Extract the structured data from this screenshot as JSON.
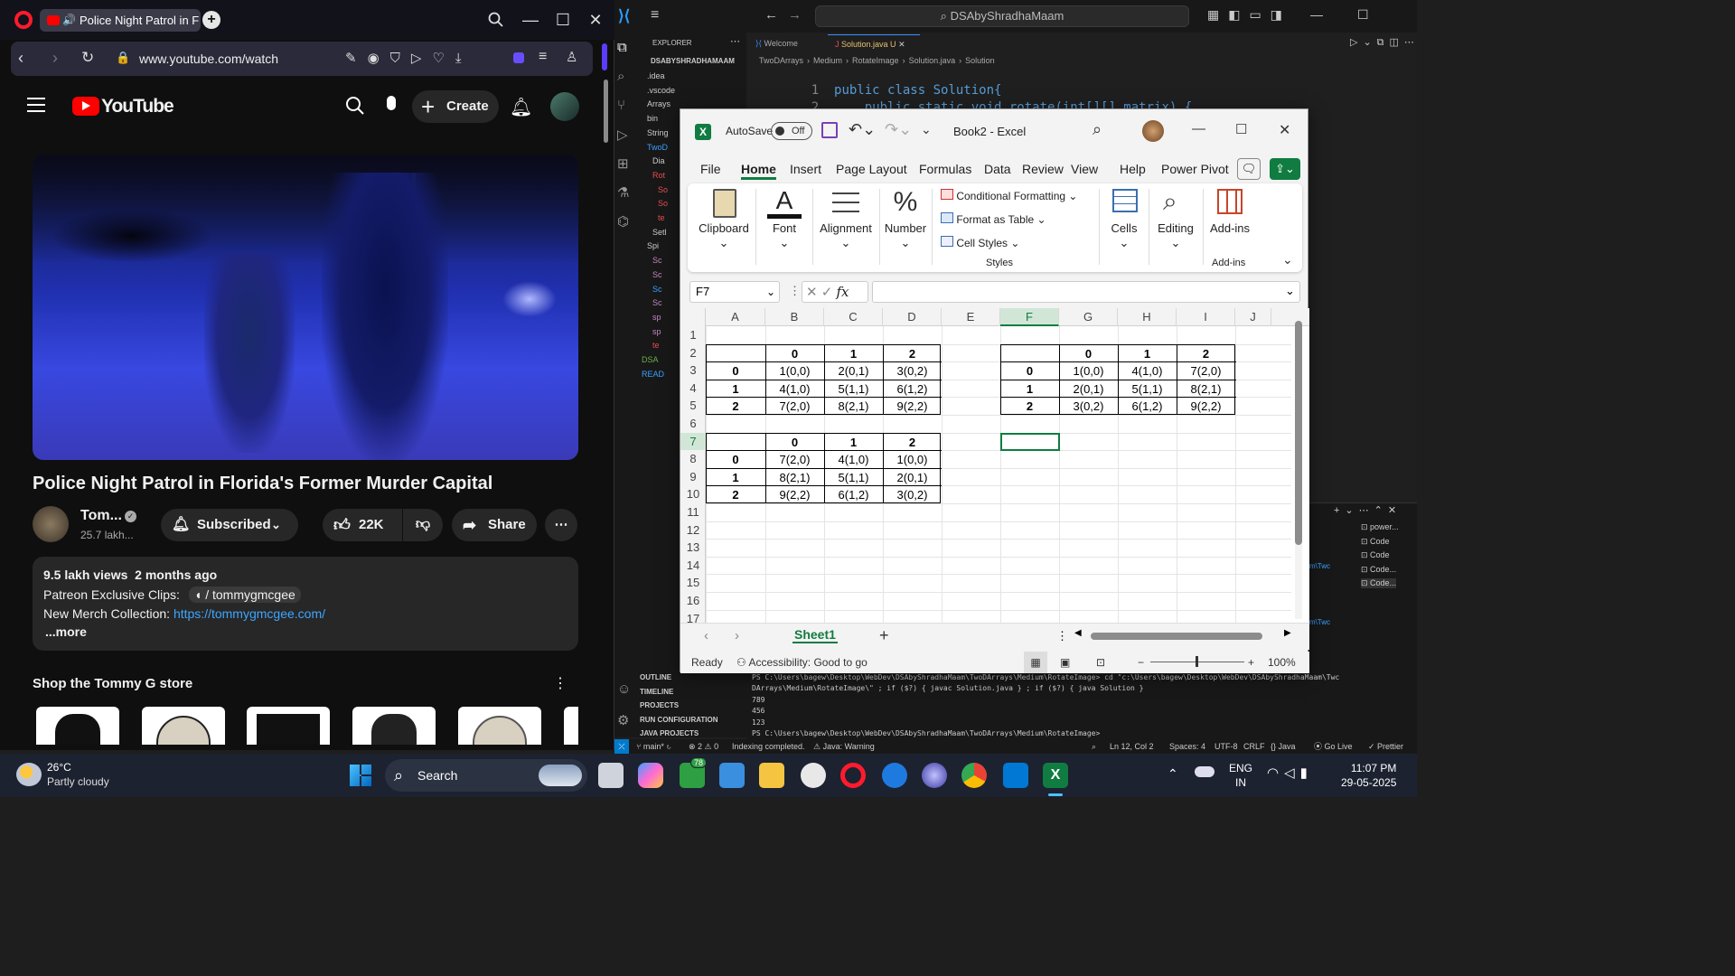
{
  "browser": {
    "tab_title": "Police Night Patrol in F",
    "url": "www.youtube.com/watch"
  },
  "youtube": {
    "logo_text": "YouTube",
    "create_label": "Create",
    "video_title": "Police Night Patrol in Florida's Former Murder Capital",
    "channel_name": "Tom...",
    "subscribers": "25.7 lakh...",
    "subscribed_label": "Subscribed",
    "likes": "22K",
    "share_label": "Share",
    "views_line": "9.5 lakh views  2 months ago",
    "desc_line1_label": "Patreon Exclusive Clips:",
    "desc_line1_link": "/ tommygmcgee",
    "desc_line2_label": "New Merch Collection:",
    "desc_line2_link": "https://tommygmcgee.com/",
    "more_label": "...more",
    "shop_title": "Shop the Tommy G store"
  },
  "vscode": {
    "search_text": "DSAbyShradhaMaam",
    "explorer_label": "EXPLORER",
    "root_folder": "DSABYSHRADHAMAAM",
    "tabs": [
      {
        "label": "Welcome"
      },
      {
        "label": "Solution.java U"
      }
    ],
    "breadcrumb": [
      "TwoDArrays",
      "Medium",
      "RotateImage",
      "Solution.java",
      "Solution"
    ],
    "code_lines": [
      {
        "num": "1",
        "text": "public class Solution{"
      },
      {
        "num": "2",
        "text": "    public static void rotate(int[][] matrix) {"
      }
    ],
    "side_items": [
      ".idea",
      ".vscode",
      "Arrays",
      "bin",
      "String",
      "TwoD",
      "Dia",
      "Rot",
      "So",
      "So",
      "te",
      "Setl",
      "Spi",
      "Sc",
      "Sc",
      "Sc",
      "Sc",
      "sp",
      "sp",
      "te",
      "DSA",
      "READ"
    ],
    "bottom_sections": [
      "OUTLINE",
      "TIMELINE",
      "PROJECTS",
      "RUN CONFIGURATION",
      "JAVA PROJECTS"
    ],
    "terminal_lines": [
      "PS C:\\Users\\bagew\\Desktop\\WebDev\\DSAbyShradhaMaam\\TwoDArrays\\Medium\\RotateImage> cd \"c:\\Users\\bagew\\Desktop\\WebDev\\DSAbyShradhaMaam\\Twc",
      "DArrays\\Medium\\RotateImage\\\" ; if ($?) { javac Solution.java } ; if ($?) { java Solution }",
      "789",
      "456",
      "123",
      "PS C:\\Users\\bagew\\Desktop\\WebDev\\DSAbyShradhaMaam\\TwoDArrays\\Medium\\RotateImage>"
    ],
    "terminal_list": [
      "power...",
      "Code",
      "Code",
      "Code...",
      "Code..."
    ],
    "terminal_side_text": "dhaMaam\\Twc",
    "status": {
      "branch": "main*",
      "problems": "⊗ 2 ⚠ 0",
      "indexing": "Indexing completed.",
      "java_warning": "Java: Warning",
      "position": "Ln 12, Col 2",
      "spaces": "Spaces: 4",
      "encoding": "UTF-8",
      "eol": "CRLF",
      "lang": "{} Java",
      "golive": "Go Live",
      "prettier": "Prettier"
    }
  },
  "excel": {
    "autosave_label": "AutoSave",
    "autosave_state": "Off",
    "title": "Book2 - Excel",
    "menu": [
      "File",
      "Home",
      "Insert",
      "Page Layout",
      "Formulas",
      "Data",
      "Review",
      "View",
      "Help",
      "Power Pivot"
    ],
    "ribbon": {
      "clipboard": "Clipboard",
      "font": "Font",
      "alignment": "Alignment",
      "number": "Number",
      "conditional": "Conditional Formatting",
      "format_table": "Format as Table",
      "cell_styles": "Cell Styles",
      "styles_group": "Styles",
      "cells": "Cells",
      "editing": "Editing",
      "addins": "Add-ins",
      "addins_group": "Add-ins"
    },
    "name_box": "F7",
    "fx_label": "fx",
    "columns": [
      "A",
      "B",
      "C",
      "D",
      "E",
      "F",
      "G",
      "H",
      "I",
      "J"
    ],
    "rows": [
      "1",
      "2",
      "3",
      "4",
      "5",
      "6",
      "7",
      "8",
      "9",
      "10",
      "11",
      "12",
      "13",
      "14",
      "15",
      "16",
      "17"
    ],
    "table1": {
      "header": [
        "0",
        "1",
        "2"
      ],
      "rows": [
        {
          "label": "0",
          "cells": [
            "1(0,0)",
            "2(0,1)",
            "3(0,2)"
          ]
        },
        {
          "label": "1",
          "cells": [
            "4(1,0)",
            "5(1,1)",
            "6(1,2)"
          ]
        },
        {
          "label": "2",
          "cells": [
            "7(2,0)",
            "8(2,1)",
            "9(2,2)"
          ]
        }
      ]
    },
    "table2": {
      "header": [
        "0",
        "1",
        "2"
      ],
      "rows": [
        {
          "label": "0",
          "cells": [
            "7(2,0)",
            "4(1,0)",
            "1(0,0)"
          ]
        },
        {
          "label": "1",
          "cells": [
            "8(2,1)",
            "5(1,1)",
            "2(0,1)"
          ]
        },
        {
          "label": "2",
          "cells": [
            "9(2,2)",
            "6(1,2)",
            "3(0,2)"
          ]
        }
      ]
    },
    "table3": {
      "header": [
        "0",
        "1",
        "2"
      ],
      "rows": [
        {
          "label": "0",
          "cells": [
            "1(0,0)",
            "4(1,0)",
            "7(2,0)"
          ]
        },
        {
          "label": "1",
          "cells": [
            "2(0,1)",
            "5(1,1)",
            "8(2,1)"
          ]
        },
        {
          "label": "2",
          "cells": [
            "3(0,2)",
            "6(1,2)",
            "9(2,2)"
          ]
        }
      ]
    },
    "sheet_tab": "Sheet1",
    "status_ready": "Ready",
    "accessibility": "Accessibility: Good to go",
    "zoom": "100%"
  },
  "taskbar": {
    "weather_temp": "26°C",
    "weather_desc": "Partly cloudy",
    "search_label": "Search",
    "badge_count": "78",
    "lang": "ENG",
    "region": "IN",
    "time": "11:07 PM",
    "date": "29-05-2025"
  }
}
